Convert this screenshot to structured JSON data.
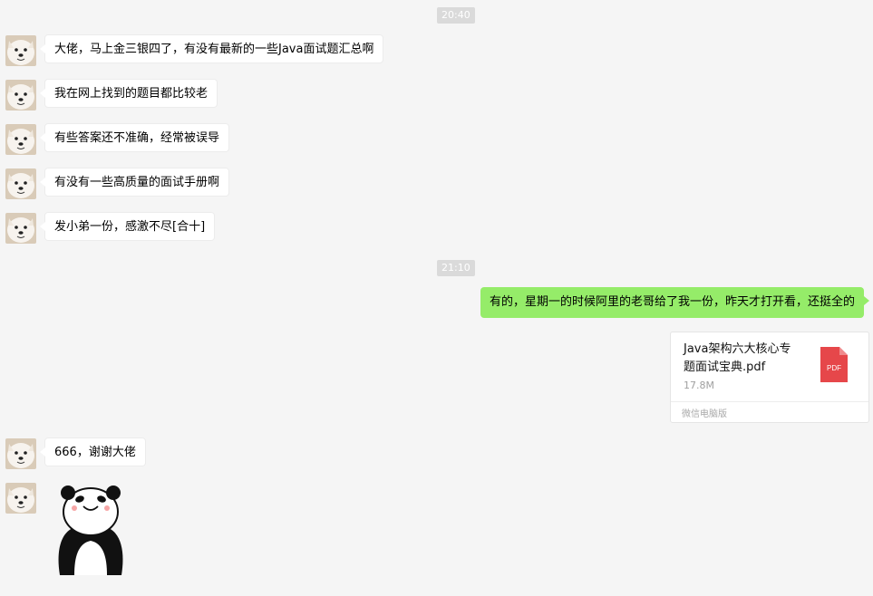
{
  "timestamps": [
    "20:40",
    "21:10"
  ],
  "messages_left_top": [
    {
      "text": "大佬，马上金三银四了，有没有最新的一些Java面试题汇总啊"
    },
    {
      "text": "我在网上找到的题目都比较老"
    },
    {
      "text": "有些答案还不准确，经常被误导"
    },
    {
      "text": "有没有一些高质量的面试手册啊"
    },
    {
      "text": "发小弟一份，感激不尽[合十]"
    }
  ],
  "reply": {
    "text": "有的，星期一的时候阿里的老哥给了我一份，昨天才打开看，还挺全的"
  },
  "file": {
    "name_line1": "Java架构六大核心专",
    "name_line2": "题面试宝典.pdf",
    "size": "17.8M",
    "source": "微信电脑版",
    "icon_label": "PDF",
    "icon": "pdf-file-icon"
  },
  "thanks": {
    "text": "666，谢谢大佬"
  },
  "colors": {
    "background": "#f5f5f5",
    "bubble_self": "#95ec69",
    "bubble_other": "#ffffff",
    "timestamp_bg": "#dadada",
    "pdf_red": "#e6474a"
  },
  "icons": {
    "avatar": "samoyed-dog-avatar",
    "sticker": "panda-meme-sticker"
  }
}
